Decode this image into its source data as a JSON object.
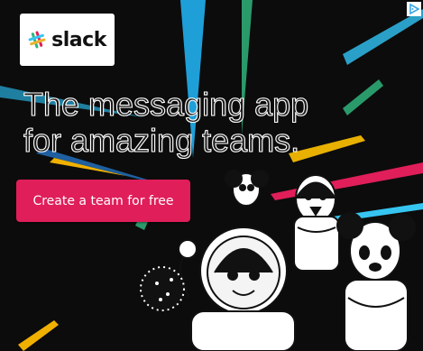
{
  "brand": {
    "name": "slack",
    "colors": {
      "red": "#e01e5a",
      "green": "#2eb67d",
      "yellow": "#ecb22e",
      "blue": "#36c5f0"
    }
  },
  "headline": {
    "line1": "The messaging app",
    "line2": "for amazing teams."
  },
  "cta": {
    "label": "Create a team for free",
    "color": "#e01e5a"
  },
  "adchoices": {
    "icon": "adchoices-triangle-icon",
    "color": "#39a6e8"
  },
  "illustration": {
    "description_icon": "cartoon-characters-illustration"
  }
}
